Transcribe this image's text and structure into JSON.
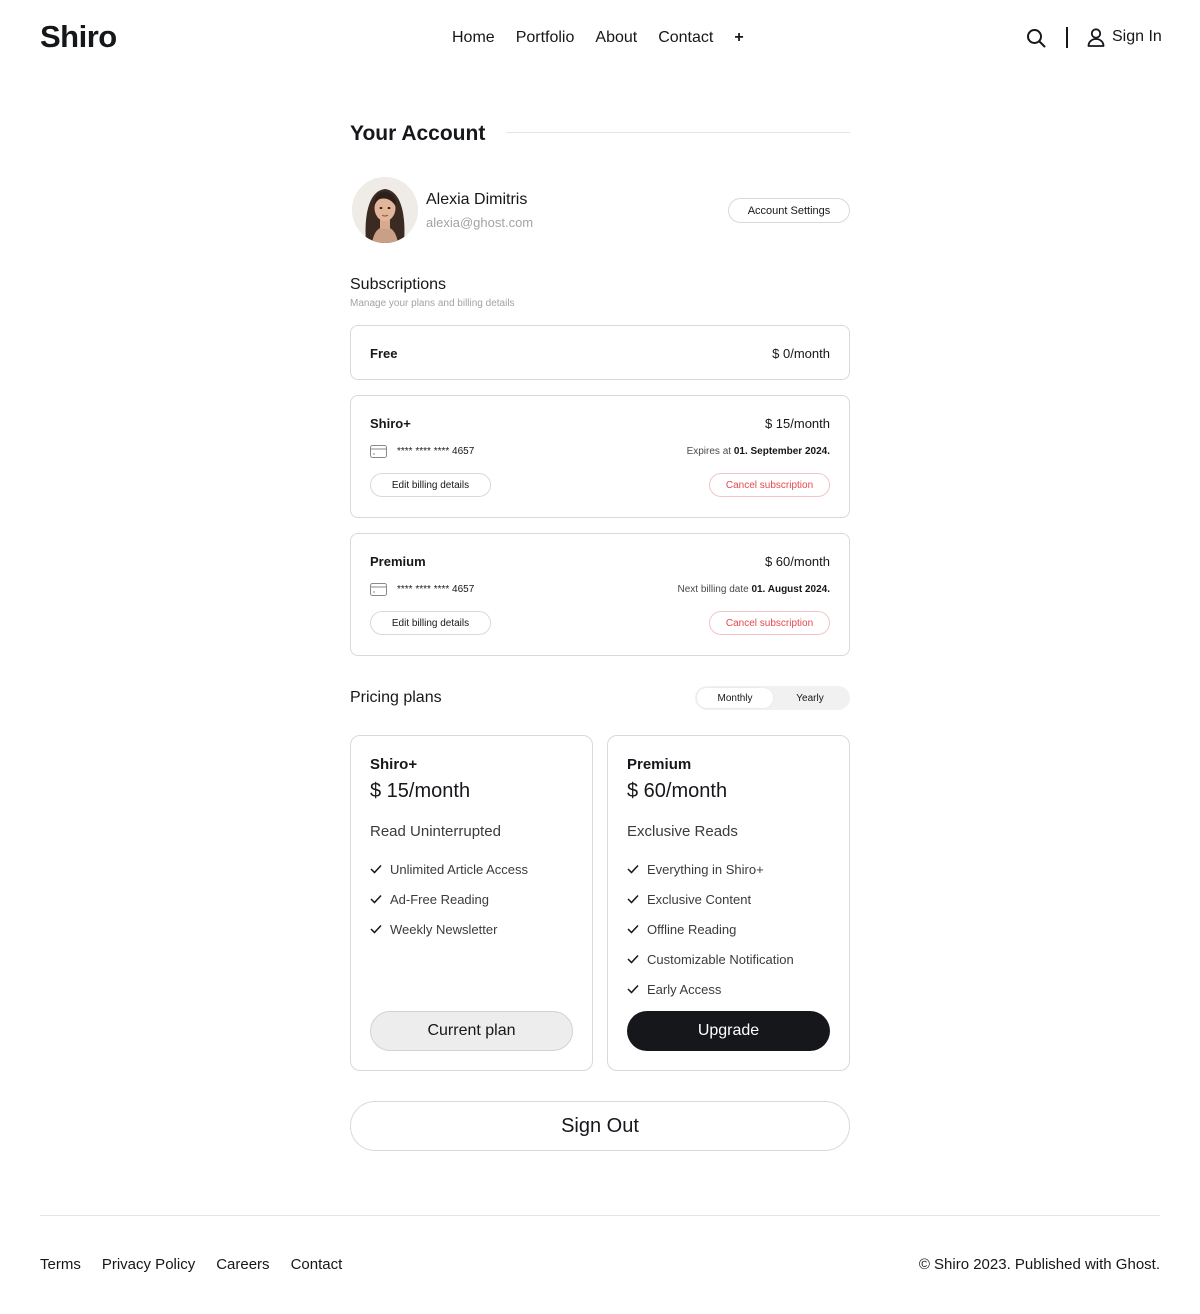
{
  "site": {
    "logo": "Shiro"
  },
  "nav": {
    "items": [
      "Home",
      "Portfolio",
      "About",
      "Contact"
    ],
    "more": "+",
    "sign_in": "Sign In"
  },
  "account": {
    "heading": "Your Account",
    "name": "Alexia Dimitris",
    "email": "alexia@ghost.com",
    "settings_button": "Account Settings"
  },
  "subscriptions": {
    "heading": "Subscriptions",
    "description": "Manage your plans and billing details",
    "items": [
      {
        "name": "Free",
        "price": "$ 0/month"
      },
      {
        "name": "Shiro+",
        "price": "$ 15/month",
        "card": "**** **** **** 4657",
        "date_label": "Expires at",
        "date": "01. September 2024.",
        "edit": "Edit billing details",
        "cancel": "Cancel subscription"
      },
      {
        "name": "Premium",
        "price": "$ 60/month",
        "card": "**** **** **** 4657",
        "date_label": "Next billing date",
        "date": "01. August 2024.",
        "edit": "Edit billing details",
        "cancel": "Cancel subscription"
      }
    ]
  },
  "pricing": {
    "heading": "Pricing plans",
    "toggle": {
      "monthly": "Monthly",
      "yearly": "Yearly",
      "selected": "Monthly"
    },
    "plans": [
      {
        "name": "Shiro+",
        "price": "$ 15/month",
        "tagline": "Read Uninterrupted",
        "features": [
          "Unlimited Article Access",
          "Ad-Free Reading",
          "Weekly Newsletter"
        ],
        "cta": "Current plan"
      },
      {
        "name": "Premium",
        "price": "$ 60/month",
        "tagline": "Exclusive Reads",
        "features": [
          "Everything in Shiro+",
          "Exclusive Content",
          "Offline Reading",
          "Customizable Notification",
          "Early Access"
        ],
        "cta": "Upgrade"
      }
    ]
  },
  "sign_out": "Sign Out",
  "footer": {
    "links": [
      "Terms",
      "Privacy Policy",
      "Careers",
      "Contact"
    ],
    "copyright": "© Shiro 2023. Published with Ghost."
  },
  "colors": {
    "text": "#15171a",
    "muted": "#a3a3a3",
    "danger": "#e5484d",
    "border": "#d9d9d9",
    "primary_button": "#15171a"
  }
}
